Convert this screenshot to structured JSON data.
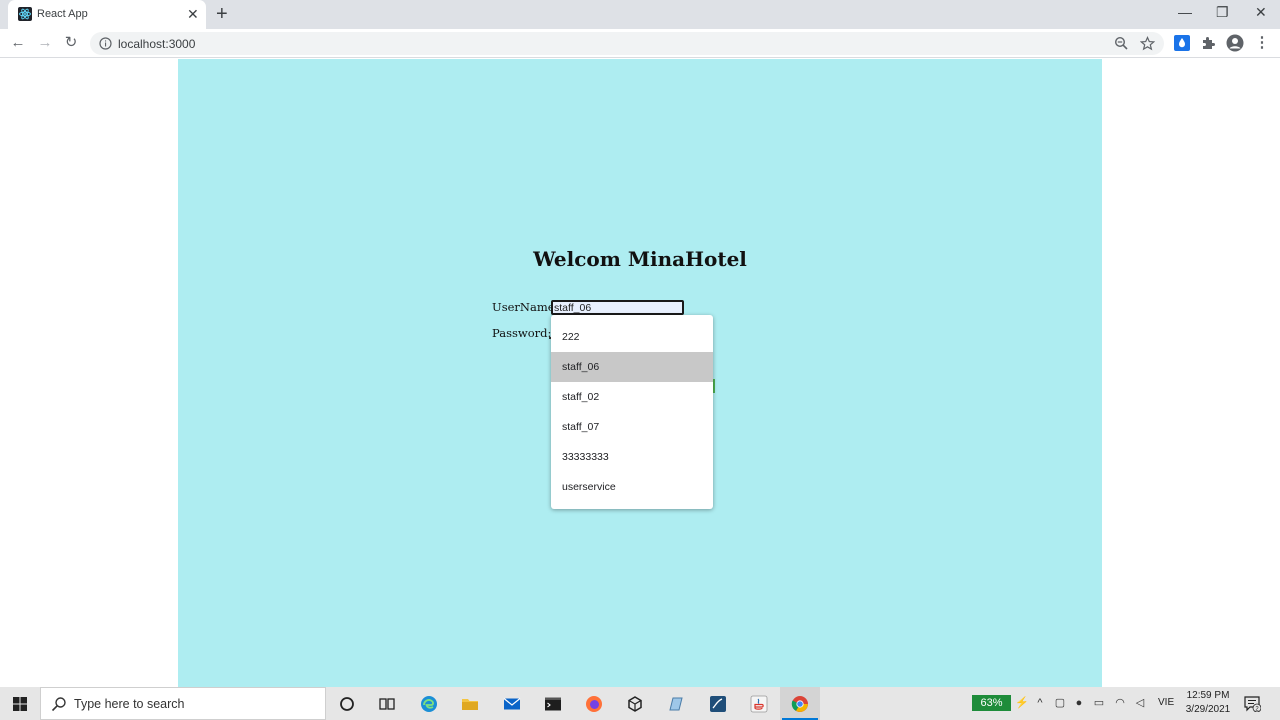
{
  "browser": {
    "tab_title": "React App",
    "url": "localhost:3000"
  },
  "page": {
    "heading": "Welcom MinaHotel",
    "username_label": "UserName:",
    "username_value": "staff_06",
    "password_label": "Password:"
  },
  "autocomplete": {
    "items": [
      "222",
      "staff_06",
      "staff_02",
      "staff_07",
      "33333333",
      "userservice"
    ],
    "selected": "staff_06"
  },
  "taskbar": {
    "search_placeholder": "Type here to search",
    "battery": "63%",
    "language": "VIE",
    "time": "12:59 PM",
    "date": "3/29/2021",
    "notification_count": "2"
  },
  "colors": {
    "panel_bg": "#aeedf1",
    "accent": "#0078d7"
  }
}
